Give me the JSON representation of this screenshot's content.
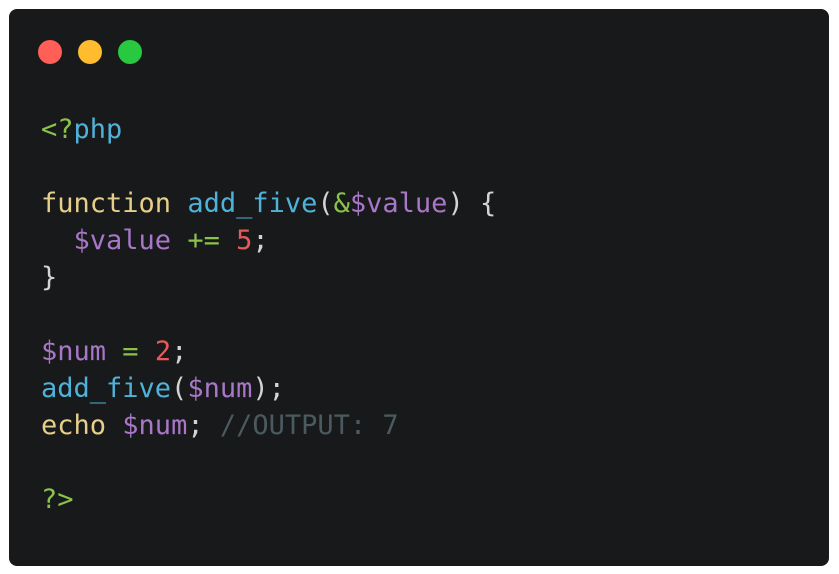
{
  "window": {
    "buttons": [
      {
        "name": "close",
        "color": "#ff5f57"
      },
      {
        "name": "minimize",
        "color": "#febc2e"
      },
      {
        "name": "maximize",
        "color": "#28c840"
      }
    ]
  },
  "code": {
    "colors": {
      "punct": "#d4d4d4",
      "keyword": "#e6cf88",
      "function": "#4fb3d9",
      "variable": "#a877c8",
      "operator": "#8bc34a",
      "number": "#e55b5b",
      "comment": "#4a5a5f",
      "tag_bracket": "#8bc34a",
      "tag_name": "#4fb3d9"
    },
    "lines": [
      [
        {
          "t": "<?",
          "c": "tag_bracket"
        },
        {
          "t": "php",
          "c": "tag_name"
        }
      ],
      [],
      [
        {
          "t": "function",
          "c": "keyword"
        },
        {
          "t": " ",
          "c": "punct"
        },
        {
          "t": "add_five",
          "c": "function"
        },
        {
          "t": "(",
          "c": "punct"
        },
        {
          "t": "&",
          "c": "operator"
        },
        {
          "t": "$value",
          "c": "variable"
        },
        {
          "t": ") {",
          "c": "punct"
        }
      ],
      [
        {
          "t": "  ",
          "c": "punct"
        },
        {
          "t": "$value",
          "c": "variable"
        },
        {
          "t": " ",
          "c": "punct"
        },
        {
          "t": "+=",
          "c": "operator"
        },
        {
          "t": " ",
          "c": "punct"
        },
        {
          "t": "5",
          "c": "number"
        },
        {
          "t": ";",
          "c": "punct"
        }
      ],
      [
        {
          "t": "}",
          "c": "punct"
        }
      ],
      [],
      [
        {
          "t": "$num",
          "c": "variable"
        },
        {
          "t": " ",
          "c": "punct"
        },
        {
          "t": "=",
          "c": "operator"
        },
        {
          "t": " ",
          "c": "punct"
        },
        {
          "t": "2",
          "c": "number"
        },
        {
          "t": ";",
          "c": "punct"
        }
      ],
      [
        {
          "t": "add_five",
          "c": "function"
        },
        {
          "t": "(",
          "c": "punct"
        },
        {
          "t": "$num",
          "c": "variable"
        },
        {
          "t": ");",
          "c": "punct"
        }
      ],
      [
        {
          "t": "echo",
          "c": "keyword"
        },
        {
          "t": " ",
          "c": "punct"
        },
        {
          "t": "$num",
          "c": "variable"
        },
        {
          "t": "; ",
          "c": "punct"
        },
        {
          "t": "//OUTPUT: 7",
          "c": "comment"
        }
      ],
      [],
      [
        {
          "t": "?>",
          "c": "tag_bracket"
        }
      ]
    ]
  }
}
